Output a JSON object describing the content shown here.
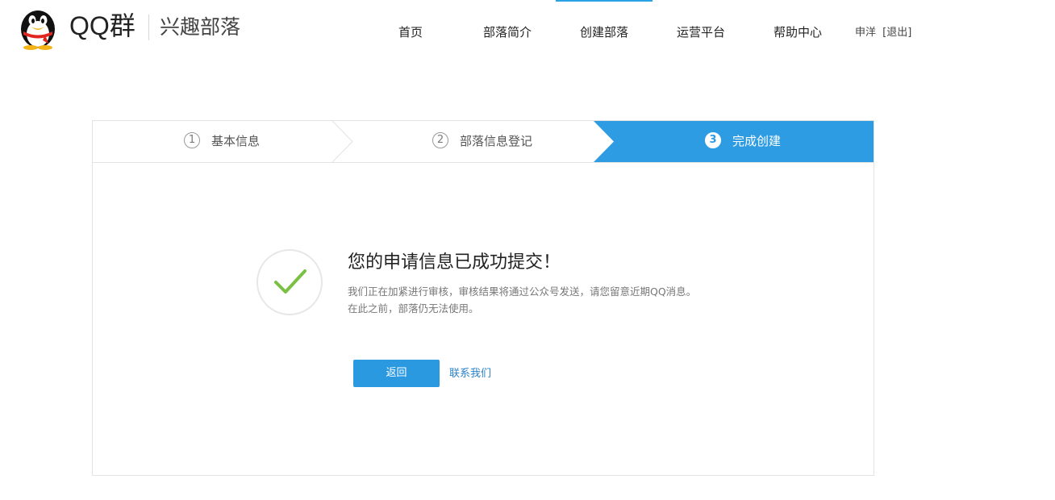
{
  "header": {
    "brand": "QQ群",
    "subbrand": "兴趣部落",
    "nav": [
      {
        "label": "首页",
        "active": false
      },
      {
        "label": "部落简介",
        "active": false
      },
      {
        "label": "创建部落",
        "active": true
      },
      {
        "label": "运营平台",
        "active": false
      },
      {
        "label": "帮助中心",
        "active": false
      }
    ],
    "user": {
      "name": "申洋",
      "logout": "[退出]"
    }
  },
  "steps": [
    {
      "num": "1",
      "label": "基本信息",
      "active": false
    },
    {
      "num": "2",
      "label": "部落信息登记",
      "active": false
    },
    {
      "num": "3",
      "label": "完成创建",
      "active": true
    }
  ],
  "result": {
    "icon": "check-icon",
    "title": "您的申请信息已成功提交！",
    "desc_line1": "我们正在加紧进行审核，审核结果将通过公众号发送，请您留意近期QQ消息。",
    "desc_line2": "在此之前，部落仍无法使用。",
    "back_button": "返回",
    "contact_link": "联系我们"
  },
  "colors": {
    "accent": "#2d9ce3",
    "check": "#7ac143",
    "link": "#2b83c8"
  }
}
